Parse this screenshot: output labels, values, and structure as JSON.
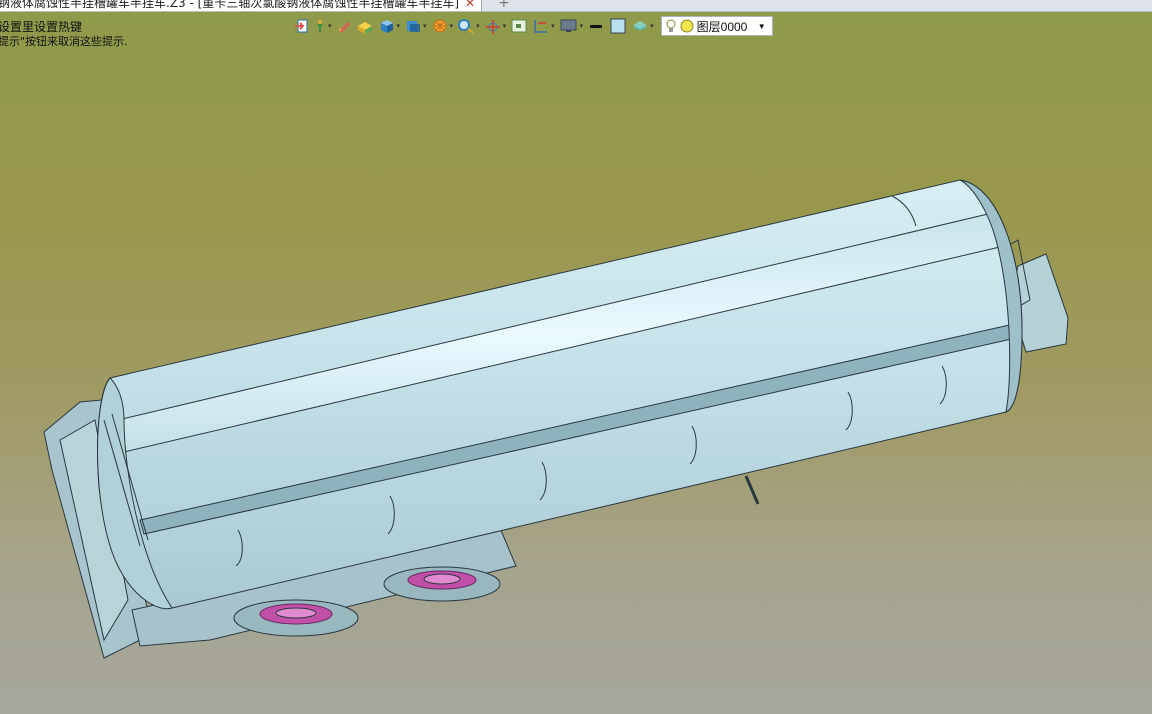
{
  "tabbar": {
    "tab_title": "钠液体腐蚀性半挂槽罐车半挂车.Z3 - [重卡三轴次氯酸钠液体腐蚀性半挂槽罐车半挂车]",
    "close_glyph": "✕",
    "add_glyph": "+"
  },
  "hints": {
    "line1": "设置里设置热键",
    "line2": "提示\"按钮来取消这些提示."
  },
  "toolbar": {
    "caret": "▾",
    "layer_name": "图层0000",
    "layer_arrow": "▼",
    "icons": [
      "exit-icon",
      "pointer-icon",
      "pen-icon",
      "box-icon",
      "cube-icon",
      "cube-blue-icon",
      "wheel-icon",
      "zoom-icon",
      "axis-icon",
      "frame-icon",
      "dimension-icon",
      "monitor-icon",
      "line-icon",
      "color-icon",
      "layer-stack-icon",
      "bulb-icon",
      "layer-state-icon"
    ]
  },
  "colors": {
    "background_top": "#8e9a4a",
    "background_bottom": "#a7a79e",
    "tank_body": "#bcd7de",
    "tank_highlight": "#e2f6fb",
    "tank_shadow": "#8fb3bd",
    "wheel_accent": "#c04fa8"
  }
}
